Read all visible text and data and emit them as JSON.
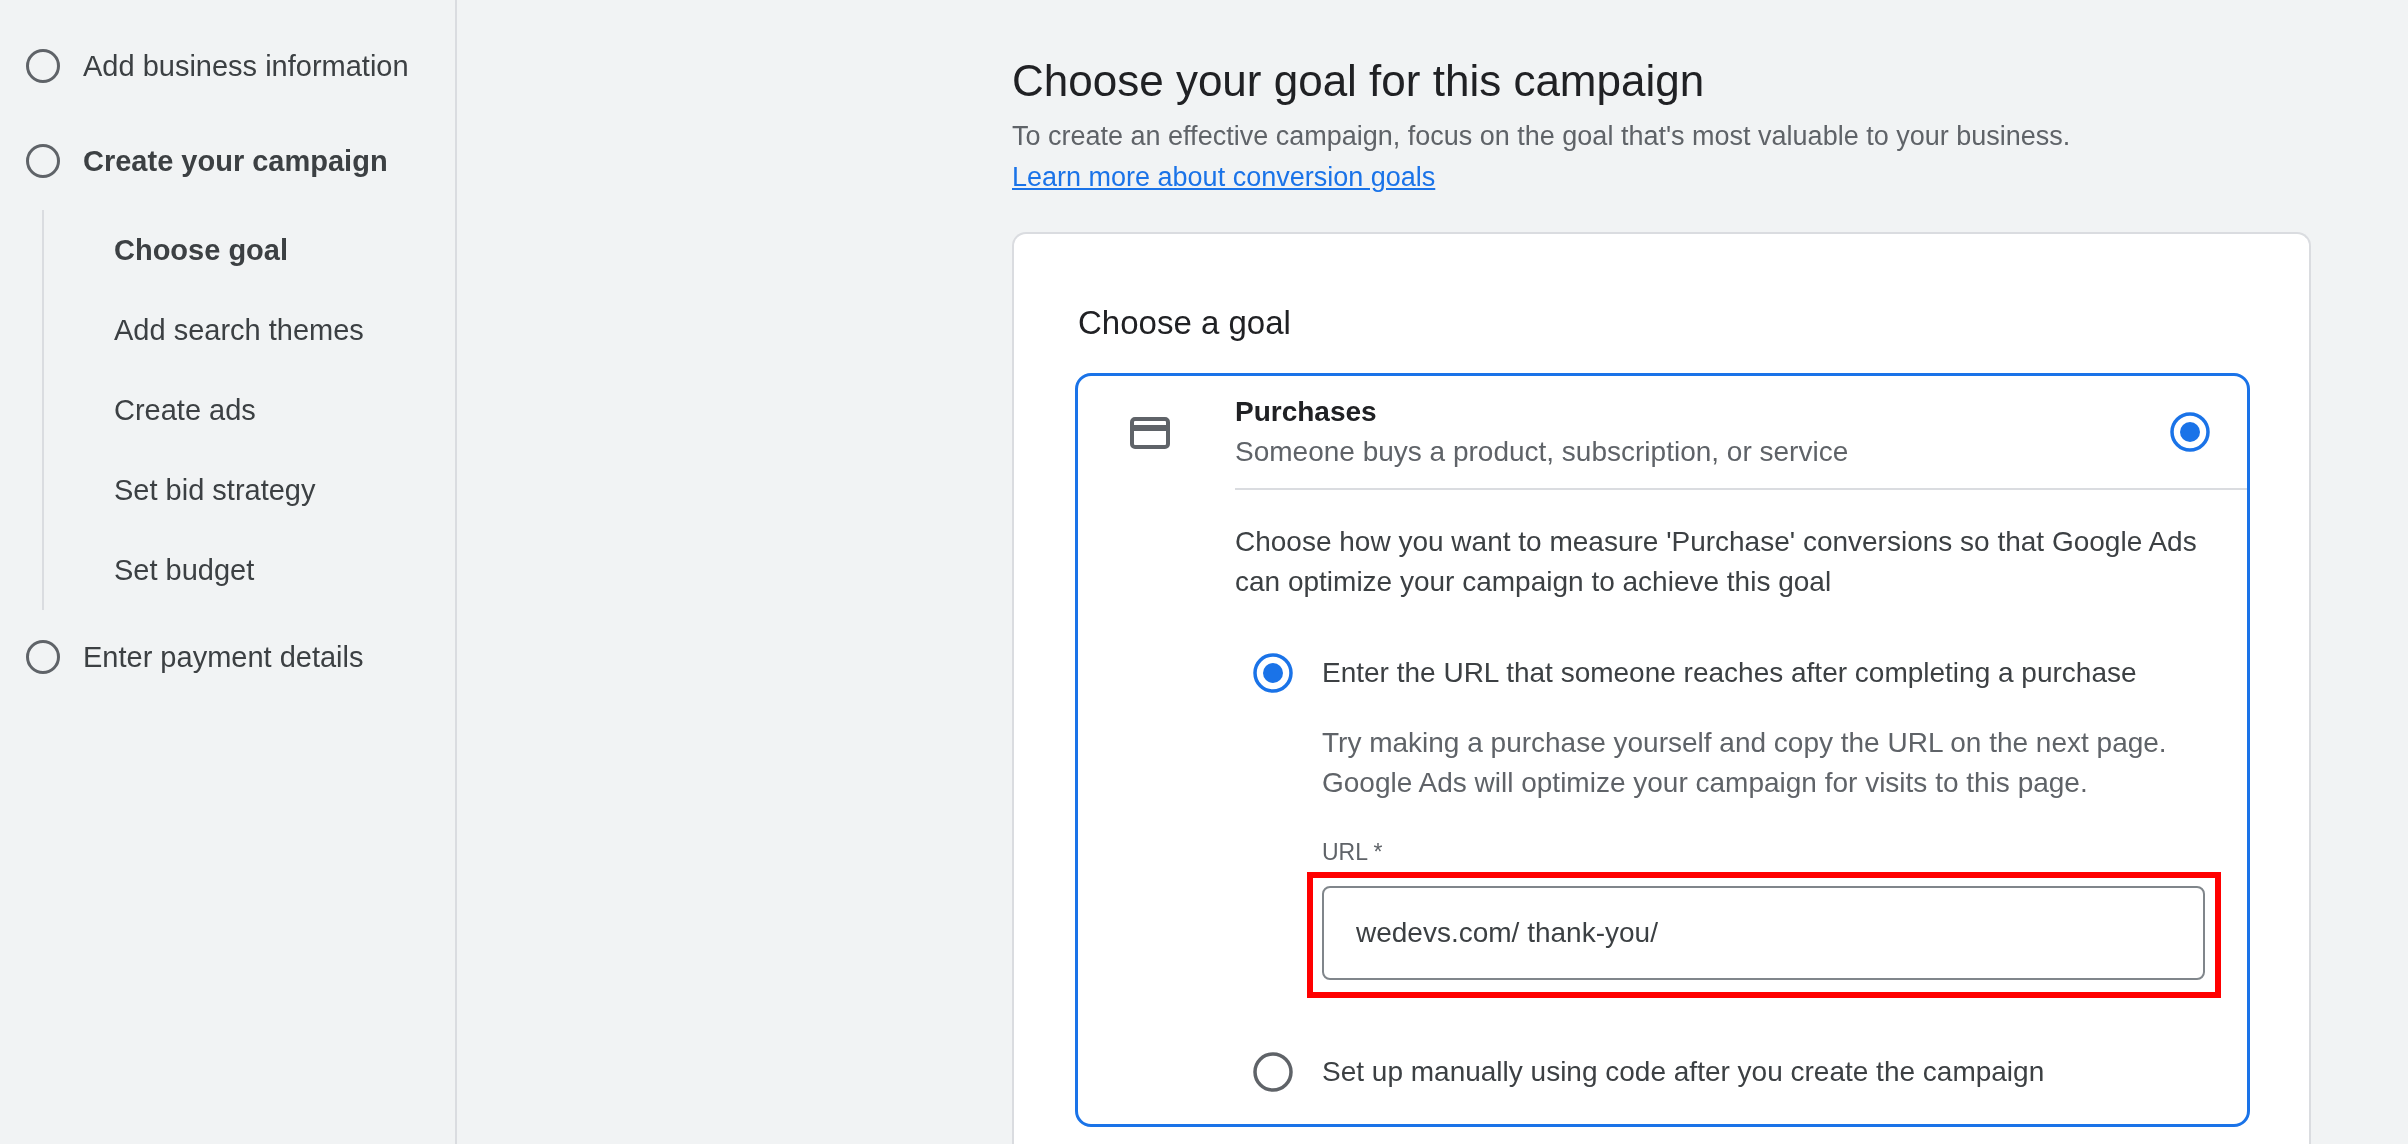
{
  "sidebar": {
    "steps": [
      {
        "label": "Add business information",
        "selected": false
      },
      {
        "label": "Create your campaign",
        "selected": true,
        "children": [
          {
            "label": "Choose goal",
            "selected": true
          },
          {
            "label": "Add search themes",
            "selected": false
          },
          {
            "label": "Create ads",
            "selected": false
          },
          {
            "label": "Set bid strategy",
            "selected": false
          },
          {
            "label": "Set budget",
            "selected": false
          }
        ]
      },
      {
        "label": "Enter payment details",
        "selected": false
      }
    ]
  },
  "header": {
    "title": "Choose your goal for this campaign",
    "description": "To create an effective campaign, focus on the goal that's most valuable to your business.",
    "link": "Learn more about conversion goals"
  },
  "goal_card": {
    "heading": "Choose a goal",
    "goals": [
      {
        "title": "Purchases",
        "subtitle": "Someone buys a product, subscription, or service",
        "selected": true,
        "prompt": "Choose how you want to measure 'Purchase' conversions so that Google Ads can optimize your campaign to achieve this goal",
        "methods": [
          {
            "label": "Enter the URL that someone reaches after completing a purchase",
            "selected": true,
            "help": "Try making a purchase yourself and copy the URL on the next page. Google Ads will optimize your campaign for visits to this page.",
            "field": {
              "label": "URL *",
              "value": "wedevs.com/ thank-you/",
              "highlighted": true
            }
          },
          {
            "label": "Set up manually using code after you create the campaign",
            "selected": false
          }
        ]
      }
    ]
  }
}
